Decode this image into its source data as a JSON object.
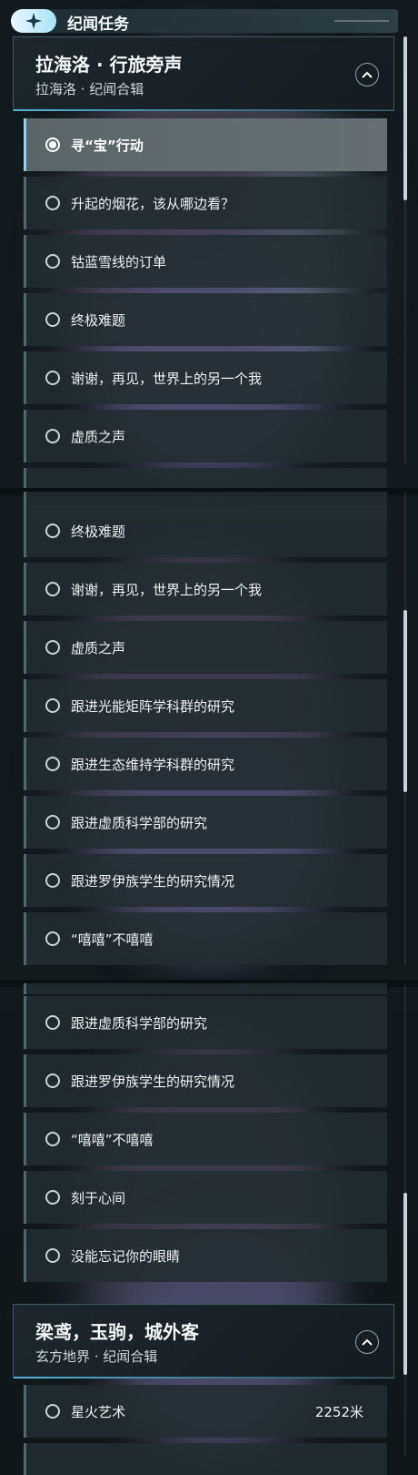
{
  "header": {
    "title": "纪闻任务"
  },
  "groups": [
    {
      "title": "拉海洛 · 行旅旁声",
      "subtitle": "拉海洛 · 纪闻合辑"
    },
    {
      "title": "梁鸢，玉驹，城外客",
      "subtitle": "玄方地界 · 纪闻合辑"
    }
  ],
  "panel1": {
    "quests": [
      {
        "label": "寻“宝”行动",
        "selected": true
      },
      {
        "label": "升起的烟花，该从哪边看？"
      },
      {
        "label": "钴蓝雪线的订单"
      },
      {
        "label": "终极难题"
      },
      {
        "label": "谢谢，再见，世界上的另一个我"
      },
      {
        "label": "虚质之声"
      }
    ]
  },
  "panel2": {
    "quests": [
      {
        "label": "终极难题"
      },
      {
        "label": "谢谢，再见，世界上的另一个我"
      },
      {
        "label": "虚质之声"
      },
      {
        "label": "跟进光能矩阵学科群的研究"
      },
      {
        "label": "跟进生态维持学科群的研究"
      },
      {
        "label": "跟进虚质科学部的研究"
      },
      {
        "label": "跟进罗伊族学生的研究情况"
      },
      {
        "label": "“嘻嘻”不嘻嘻"
      }
    ]
  },
  "panel3": {
    "quests": [
      {
        "label": "跟进虚质科学部的研究"
      },
      {
        "label": "跟进罗伊族学生的研究情况"
      },
      {
        "label": "“嘻嘻”不嘻嘻"
      },
      {
        "label": "刻于心间"
      },
      {
        "label": "没能忘记你的眼睛"
      }
    ],
    "group2_quests": [
      {
        "label": "星火艺术",
        "distance": "2252米"
      }
    ]
  },
  "colors": {
    "accent": "#8bd4ee",
    "row_bg": "#222c30",
    "active_row_bg": "#606a6c",
    "background": "#13191c"
  },
  "icons": {
    "header_badge": "sparkle-star-icon",
    "group_toggle": "chevron-up-icon",
    "quest_radio": "radio-circle-icon"
  }
}
